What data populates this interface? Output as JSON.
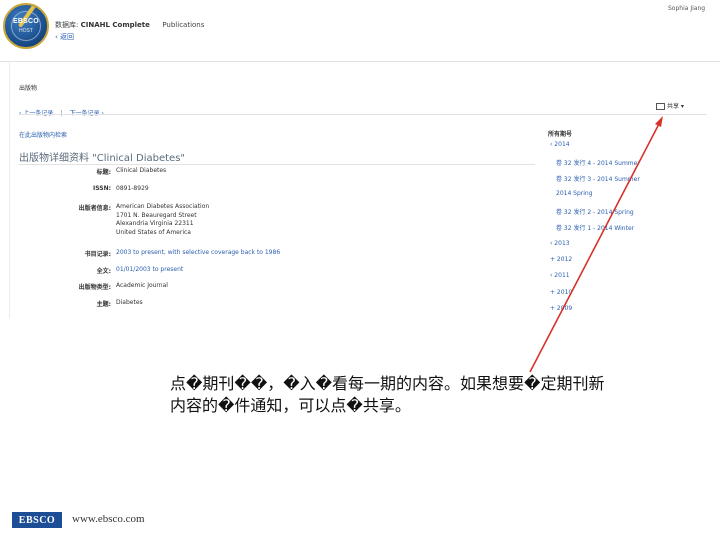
{
  "header": {
    "database_label": "数据库:",
    "database_name": "CINAHL Complete",
    "section_name": "Publications",
    "back_link": "‹ 返回",
    "user_name": "Sophia Jiang",
    "logo_text": "EBSCO",
    "logo_subtext": "HOST"
  },
  "record_nav": {
    "section_title": "出版物",
    "prev_label": "‹ 上一条记录",
    "separator": "|",
    "next_label": "下一条记录 ›",
    "share_label": "共享 ▾"
  },
  "detail": {
    "section_title": "在此出版物内检索",
    "title": "出版物详细资料 \"Clinical Diabetes\"",
    "fields": [
      {
        "label": "标题:",
        "values": [
          "Clinical Diabetes"
        ],
        "link": false
      },
      {
        "label": "ISSN:",
        "values": [
          "0891-8929"
        ],
        "link": false
      },
      {
        "label": "出版者信息:",
        "values": [
          "American Diabetes Association",
          "1701 N. Beauregard Street",
          "Alexandria Virginia 22311",
          "United States of America"
        ],
        "link": false
      },
      {
        "label": "书目记录:",
        "values": [
          "2003 to present, with selective coverage back to 1986"
        ],
        "link": true
      },
      {
        "label": "全文:",
        "values": [
          "01/01/2003 to present"
        ],
        "link": true
      },
      {
        "label": "出版物类型:",
        "values": [
          "Academic Journal"
        ],
        "link": false
      },
      {
        "label": "主题:",
        "values": [
          "Diabetes"
        ],
        "link": false
      }
    ]
  },
  "issues": {
    "heading": "所有期号",
    "items": [
      {
        "text": "‹ 2014",
        "indent": 1
      },
      {
        "text": "卷 32 发行 4 - 2014 Summer",
        "indent": 2
      },
      {
        "text": "卷 32 发行 3 - 2014 Summer",
        "indent": 2
      },
      {
        "text": "2014 Spring",
        "indent": 2
      },
      {
        "text": "卷 32 发行 2 - 2014 Spring",
        "indent": 2
      },
      {
        "text": "卷 32 发行 1 - 2014 Winter",
        "indent": 2
      },
      {
        "text": "‹ 2013",
        "indent": 1
      },
      {
        "text": "+ 2012",
        "indent": 1
      },
      {
        "text": "‹ 2011",
        "indent": 1
      },
      {
        "text": "+ 2010",
        "indent": 1
      },
      {
        "text": "+ 2009",
        "indent": 1
      }
    ]
  },
  "annotation": {
    "caption": "点�期刊��，�入�看每一期的内容。如果想要�定期刊新内容的�件通知，可以点�共享。",
    "arrow_color": "#d9312b"
  },
  "footer": {
    "logo_text": "EBSCO",
    "url": "www.ebsco.com"
  }
}
